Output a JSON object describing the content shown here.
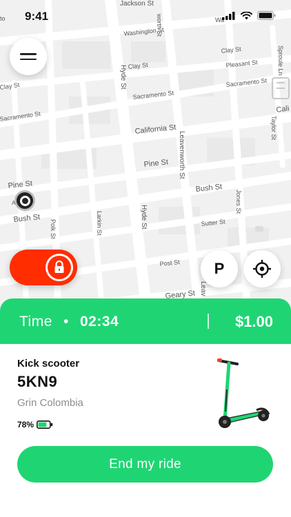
{
  "status_bar": {
    "time": "9:41"
  },
  "map": {
    "streets": {
      "jackson": "Jackson St",
      "worth": "worth St",
      "washington": "Washington St",
      "wa": "Wa",
      "clay_left": "Clay St",
      "clay_right": "Clay St",
      "pleasant": "Pleasant St",
      "sacramento_left": "Sacramento St",
      "sacramento_mid": "Sacramento St",
      "sacramento_right": "Sacramento St",
      "sproule": "Sproule Ln",
      "hyde_top": "Hyde St",
      "california": "California St",
      "cali": "Cali",
      "taylor": "Taylor St",
      "leavenworth": "Leavenworth St",
      "pine_mid": "Pine St",
      "pine_left": "Pine St",
      "bush_left": "Bush St",
      "bush_right": "Bush St",
      "jones": "Jones St",
      "au": "Au",
      "polk": "Polk St",
      "larkin": "Larkin St",
      "hyde_bottom": "Hyde St",
      "sutter": "Sutter St",
      "post": "Post St",
      "geary": "Geary St",
      "leav_bottom": "Leav",
      "ay": "ay St",
      "to": "to"
    }
  },
  "controls": {
    "parking_label": "P"
  },
  "ride": {
    "time_label": "Time",
    "time_value": "02:34",
    "price": "$1.00"
  },
  "vehicle": {
    "type": "Kick scooter",
    "code": "5KN9",
    "operator": "Grin Colombia",
    "battery": "78%",
    "battery_level": 0.78
  },
  "actions": {
    "end_ride_label": "End my ride"
  },
  "colors": {
    "accent_green": "#1fd573",
    "lock_red": "#ff2d00"
  }
}
